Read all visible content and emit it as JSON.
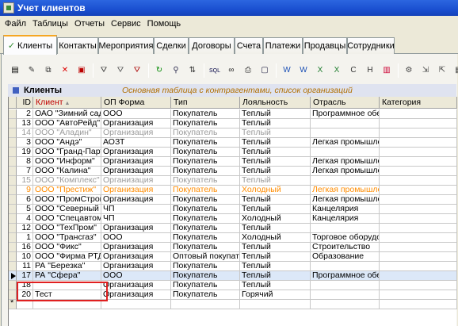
{
  "window": {
    "title": "Учет клиентов"
  },
  "menu": [
    "Файл",
    "Таблицы",
    "Отчеты",
    "Сервис",
    "Помощь"
  ],
  "tabs": [
    {
      "label": "Клиенты",
      "active": true
    },
    {
      "label": "Контакты"
    },
    {
      "label": "Мероприятия"
    },
    {
      "label": "Сделки"
    },
    {
      "label": "Договоры"
    },
    {
      "label": "Счета"
    },
    {
      "label": "Платежи"
    },
    {
      "label": "Продавцы"
    },
    {
      "label": "Сотрудники"
    }
  ],
  "toolbar_icons": [
    "new-record-icon",
    "edit-icon",
    "copy-icon",
    "delete-icon",
    "delete-all-icon",
    "filter-icon",
    "filter-clear-icon",
    "filter-remove-icon",
    "refresh-icon",
    "find-icon",
    "sort-icon",
    "sql-icon",
    "binoculars-icon",
    "print-icon",
    "preview-icon",
    "word-icon",
    "word-export-icon",
    "excel-icon",
    "excel-export-icon",
    "csv-icon",
    "html-icon",
    "chart-icon",
    "settings-icon",
    "export-icon",
    "import-icon",
    "layout-icon",
    "exit-icon"
  ],
  "grid": {
    "title": "Клиенты",
    "description": "Основная таблица с контрагентами, список организаций",
    "columns": [
      "ID",
      "Клиент",
      "ОП Форма",
      "Тип",
      "Лояльность",
      "Отрасль",
      "Категория"
    ],
    "rows": [
      {
        "id": "2",
        "client": "ОАО \"Зимний сад\"",
        "form": "ООО",
        "type": "Покупатель",
        "loyalty": "Теплый",
        "industry": "Программное обес",
        "category": "",
        "style": "normal"
      },
      {
        "id": "13",
        "client": "ООО \"АвтоРейд\"",
        "form": "Организация",
        "type": "Покупатель",
        "loyalty": "Теплый",
        "industry": "",
        "category": "",
        "style": "normal"
      },
      {
        "id": "14",
        "client": "ООО \"Аладин\"",
        "form": "Организация",
        "type": "Покупатель",
        "loyalty": "Теплый",
        "industry": "",
        "category": "",
        "style": "gray"
      },
      {
        "id": "3",
        "client": "ООО \"Андэ\"",
        "form": "АОЗТ",
        "type": "Покупатель",
        "loyalty": "Теплый",
        "industry": "Легкая промышлен",
        "category": "",
        "style": "normal"
      },
      {
        "id": "19",
        "client": "ООО \"Гранд-Партн",
        "form": "Организация",
        "type": "Покупатель",
        "loyalty": "Теплый",
        "industry": "",
        "category": "",
        "style": "normal"
      },
      {
        "id": "8",
        "client": "ООО \"Информ\"",
        "form": "Организация",
        "type": "Покупатель",
        "loyalty": "Теплый",
        "industry": "Легкая промышлен",
        "category": "",
        "style": "normal"
      },
      {
        "id": "7",
        "client": "ООО \"Калина\"",
        "form": "Организация",
        "type": "Покупатель",
        "loyalty": "Теплый",
        "industry": "Легкая промышлен",
        "category": "",
        "style": "normal"
      },
      {
        "id": "15",
        "client": "ООО \"Комплекс\"",
        "form": "Организация",
        "type": "Покупатель",
        "loyalty": "Теплый",
        "industry": "",
        "category": "",
        "style": "gray"
      },
      {
        "id": "9",
        "client": "ООО \"Престиж\"",
        "form": "Организация",
        "type": "Покупатель",
        "loyalty": "Холодный",
        "industry": "Легкая промышлен",
        "category": "",
        "style": "orange"
      },
      {
        "id": "6",
        "client": "ООО \"ПромСтрой\"",
        "form": "Организация",
        "type": "Покупатель",
        "loyalty": "Теплый",
        "industry": "Легкая промышлен",
        "category": "",
        "style": "normal"
      },
      {
        "id": "5",
        "client": "ООО \"Северный Бр",
        "form": "ЧП",
        "type": "Покупатель",
        "loyalty": "Теплый",
        "industry": "Канцелярия",
        "category": "",
        "style": "normal"
      },
      {
        "id": "4",
        "client": "ООО \"Спецавтомат",
        "form": "ЧП",
        "type": "Покупатель",
        "loyalty": "Холодный",
        "industry": "Канцелярия",
        "category": "",
        "style": "normal"
      },
      {
        "id": "12",
        "client": "ООО \"ТехПром\"",
        "form": "Организация",
        "type": "Покупатель",
        "loyalty": "Теплый",
        "industry": "",
        "category": "",
        "style": "normal"
      },
      {
        "id": "1",
        "client": "ООО \"Трансгаз\"",
        "form": "ООО",
        "type": "Покупатель",
        "loyalty": "Холодный",
        "industry": "Торговое оборудов",
        "category": "",
        "style": "normal"
      },
      {
        "id": "16",
        "client": "ООО \"Фикс\"",
        "form": "Организация",
        "type": "Покупатель",
        "loyalty": "Теплый",
        "industry": "Строительство",
        "category": "",
        "style": "normal"
      },
      {
        "id": "10",
        "client": "ООО \"Фирма РТД\"",
        "form": "Организация",
        "type": "Оптовый покупате",
        "loyalty": "Теплый",
        "industry": "Образование",
        "category": "",
        "style": "normal"
      },
      {
        "id": "11",
        "client": "РА \"Березка\"",
        "form": "Организация",
        "type": "Покупатель",
        "loyalty": "Теплый",
        "industry": "",
        "category": "",
        "style": "normal"
      },
      {
        "id": "17",
        "client": "РА \"Сфера\"",
        "form": "ООО",
        "type": "Покупатель",
        "loyalty": "Теплый",
        "industry": "Программное обес",
        "category": "",
        "style": "selected"
      },
      {
        "id": "18",
        "client": "",
        "form": "Организация",
        "type": "Покупатель",
        "loyalty": "Теплый",
        "industry": "",
        "category": "",
        "style": "normal"
      },
      {
        "id": "20",
        "client": "Тест",
        "form": "Организация",
        "type": "Покупатель",
        "loyalty": "Горячий",
        "industry": "",
        "category": "",
        "style": "normal"
      }
    ],
    "new_row_marker": "*"
  }
}
